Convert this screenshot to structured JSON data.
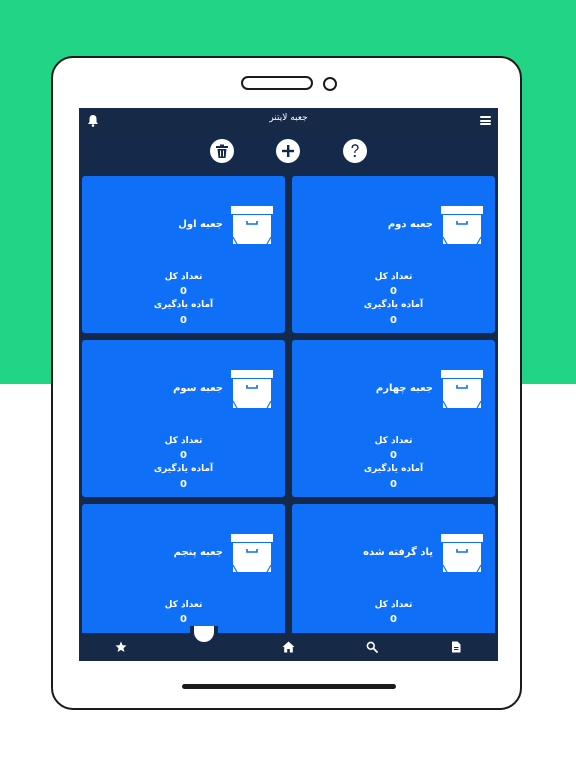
{
  "app": {
    "title": "جعبه لایتنر"
  },
  "toolbar": {
    "delete_icon": "trash-icon",
    "add_icon": "plus-icon",
    "help_icon": "question-icon"
  },
  "cards": [
    {
      "name": "جعبه دوم",
      "total_label": "تعداد کل",
      "total": "0",
      "ready_label": "آماده یادگیری",
      "ready": "0"
    },
    {
      "name": "جعبه اول",
      "total_label": "تعداد کل",
      "total": "0",
      "ready_label": "آماده یادگیری",
      "ready": "0"
    },
    {
      "name": "جعبه چهارم",
      "total_label": "تعداد کل",
      "total": "0",
      "ready_label": "آماده یادگیری",
      "ready": "0"
    },
    {
      "name": "جعبه سوم",
      "total_label": "تعداد کل",
      "total": "0",
      "ready_label": "آماده یادگیری",
      "ready": "0"
    },
    {
      "name": "یاد گرفته شده",
      "total_label": "تعداد کل",
      "total": "0",
      "ready_label": "",
      "ready": ""
    },
    {
      "name": "جعبه پنجم",
      "total_label": "تعداد کل",
      "total": "0",
      "ready_label": "",
      "ready": ""
    }
  ],
  "bottom_nav": [
    "star-icon",
    "box-icon",
    "home-icon",
    "search-icon",
    "document-icon"
  ],
  "colors": {
    "background_top": "#22d485",
    "screen_bg": "#15294a",
    "card_bg": "#0f6ff6"
  }
}
